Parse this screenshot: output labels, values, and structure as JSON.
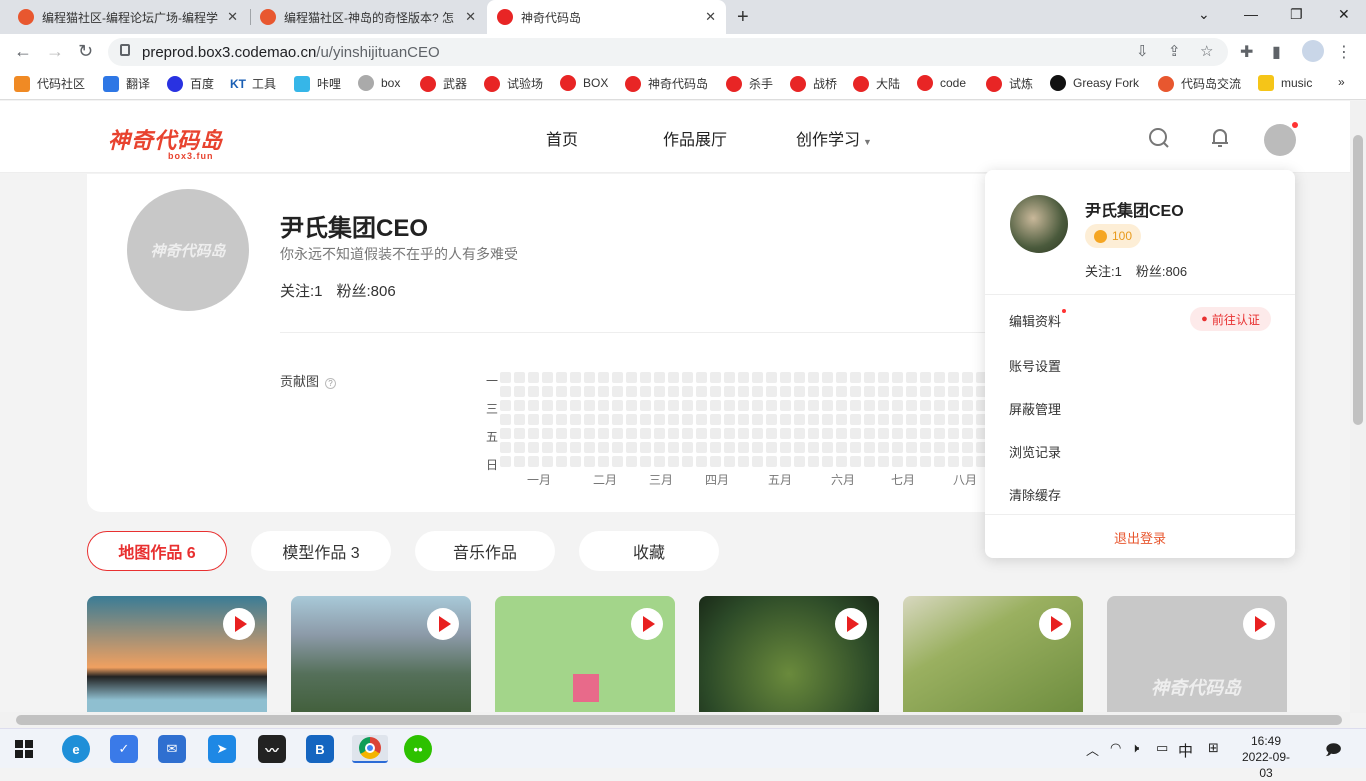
{
  "browser": {
    "tabs": [
      {
        "title": "编程猫社区-编程论坛广场-编程学",
        "icon": "codemao-icon"
      },
      {
        "title": "编程猫社区-神岛的奇怪版本? 怎",
        "icon": "codemao-icon"
      },
      {
        "title": "神奇代码岛",
        "icon": "box3-icon"
      }
    ],
    "url_main": "preprod.box3.codemao.cn",
    "url_path": "/u/yinshijituanCEO",
    "bookmarks": [
      "代码社区",
      "翻译",
      "百度",
      "工具",
      "咔哩",
      "box",
      "武器",
      "试验场",
      "BOX",
      "神奇代码岛",
      "杀手",
      "战桥",
      "大陆",
      "code",
      "试炼",
      "Greasy Fork",
      "代码岛交流",
      "music"
    ],
    "bookmark_prefixes": {
      "tool": "KT"
    },
    "more_symbol": "»"
  },
  "site": {
    "logo": "神奇代码岛",
    "logo_sub": "box3.fun",
    "nav": [
      "首页",
      "作品展厅",
      "创作学习"
    ]
  },
  "profile": {
    "name": "尹氏集团CEO",
    "motto": "你永远不知道假装不在乎的人有多难受",
    "follow": "关注:1",
    "fans": "粉丝:806",
    "contrib_label": "贡献图",
    "day_labels": [
      "一",
      "三",
      "五",
      "日"
    ],
    "months": [
      "一月",
      "二月",
      "三月",
      "四月",
      "五月",
      "六月",
      "七月",
      "八月"
    ]
  },
  "work_tabs": [
    "地图作品 6",
    "模型作品 3",
    "音乐作品",
    "收藏"
  ],
  "dropdown": {
    "name": "尹氏集团CEO",
    "level": "100",
    "follow": "关注:1",
    "fans": "粉丝:806",
    "items": [
      "编辑资料",
      "账号设置",
      "屏蔽管理",
      "浏览记录",
      "清除缓存"
    ],
    "cert": "前往认证",
    "logout": "退出登录"
  },
  "taskbar": {
    "ime": "中",
    "time": "16:49",
    "date": "2022-09-03"
  },
  "colors": {
    "accent": "#e83030",
    "brand": "#e8432f"
  }
}
